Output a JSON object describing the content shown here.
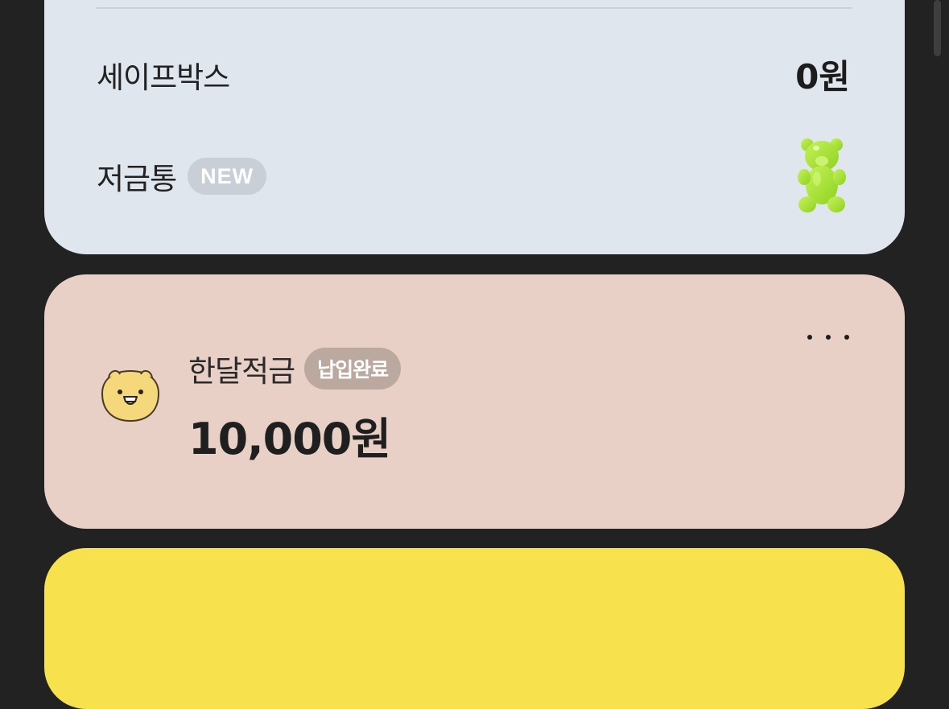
{
  "safebox": {
    "label": "세이프박스",
    "value": "0원"
  },
  "jar": {
    "label": "저금통",
    "badge": "NEW",
    "icon": "gummy-bear-icon"
  },
  "monthly_saving": {
    "title": "한달적금",
    "badge": "납입완료",
    "amount": "10,000원",
    "avatar": "lion-character-avatar",
    "more_icon": "more-horizontal-icon"
  },
  "colors": {
    "background": "#222222",
    "card_top": "#dfe6ed",
    "card_mid": "#e8d0c6",
    "card_bottom": "#f7e14c",
    "badge_new": "#c8cfd7",
    "badge_paid": "#bba89e",
    "bear": "#a4e23c"
  }
}
